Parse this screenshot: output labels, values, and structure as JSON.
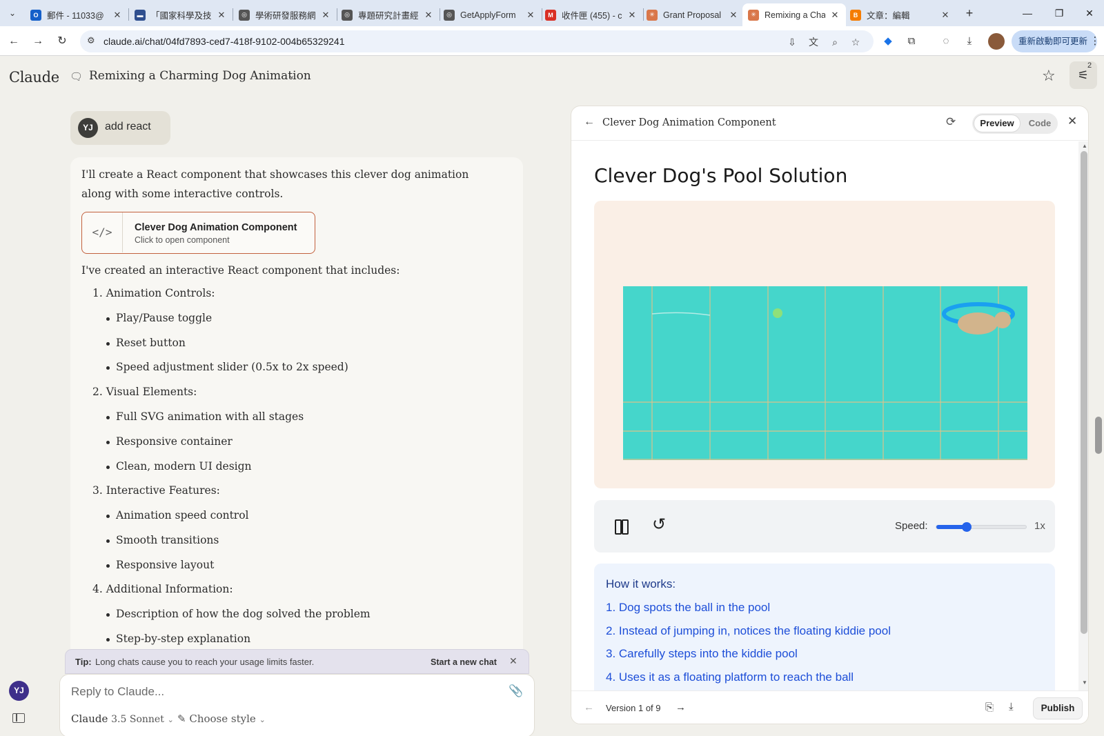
{
  "browser": {
    "tabs": [
      {
        "title": "郵件 - 11033@",
        "icon": "outlook-icon",
        "color": "#1560c9",
        "glyph": "O"
      },
      {
        "title": "「國家科學及技",
        "icon": "site-icon",
        "color": "#2f4f8f",
        "glyph": "▬"
      },
      {
        "title": "學術研發服務網",
        "icon": "globe-icon",
        "color": "#555555",
        "glyph": "◎"
      },
      {
        "title": "專題研究計畫經",
        "icon": "globe-icon",
        "color": "#555555",
        "glyph": "◎"
      },
      {
        "title": "GetApplyForm",
        "icon": "globe-icon",
        "color": "#555555",
        "glyph": "◎"
      },
      {
        "title": "收件匣 (455) - c",
        "icon": "gmail-icon",
        "color": "#d93025",
        "glyph": "M"
      },
      {
        "title": "Grant Proposal",
        "icon": "claude-icon",
        "color": "#d9774a",
        "glyph": "✳"
      },
      {
        "title": "Remixing a Cha",
        "icon": "claude-icon",
        "color": "#d9774a",
        "glyph": "✳"
      },
      {
        "title": "文章：編輯",
        "icon": "blogger-icon",
        "color": "#f57c00",
        "glyph": "B"
      }
    ],
    "url": "claude.ai/chat/04fd7893-ced7-418f-9102-004b65329241",
    "update_button": "重新啟動即可更新"
  },
  "app": {
    "logo": "Claude",
    "chat_title": "Remixing a Charming Dog Animation",
    "settings_badge": "2"
  },
  "chat": {
    "user_initials": "YJ",
    "user_message": "add react",
    "intro_line1": "I'll create a React component that showcases this clever dog animation",
    "intro_line2": "along with some interactive controls.",
    "artifact": {
      "title": "Clever Dog Animation Component",
      "subtitle": "Click to open component",
      "icon": "</>"
    },
    "includes_heading": "I've created an interactive React component that includes:",
    "sections": [
      {
        "label": "1. Animation Controls:",
        "bullets": [
          "Play/Pause toggle",
          "Reset button",
          "Speed adjustment slider (0.5x to 2x speed)"
        ]
      },
      {
        "label": "2. Visual Elements:",
        "bullets": [
          "Full SVG animation with all stages",
          "Responsive container",
          "Clean, modern UI design"
        ]
      },
      {
        "label": "3. Interactive Features:",
        "bullets": [
          "Animation speed control",
          "Smooth transitions",
          "Responsive layout"
        ]
      },
      {
        "label": "4. Additional Information:",
        "bullets": [
          "Description of how the dog solved the problem",
          "Step-by-step explanation"
        ]
      }
    ],
    "tip_label": "Tip:",
    "tip_text": "Long chats cause you to reach your usage limits faster.",
    "tip_link": "Start a new chat",
    "composer_placeholder": "Reply to Claude...",
    "model_name": "Claude",
    "model_version": "3.5 Sonnet",
    "style_label": "Choose style"
  },
  "panel": {
    "title": "Clever Dog Animation Component",
    "tab_preview": "Preview",
    "tab_code": "Code",
    "component_title": "Clever Dog's Pool Solution",
    "speed_label": "Speed:",
    "speed_value": "1x",
    "speed_fraction": 0.33,
    "howto_title": "How it works:",
    "steps": [
      "1. Dog spots the ball in the pool",
      "2. Instead of jumping in, notices the floating kiddie pool",
      "3. Carefully steps into the kiddie pool",
      "4. Uses it as a floating platform to reach the ball"
    ],
    "version_text": "Version 1 of 9",
    "publish_label": "Publish"
  },
  "colors": {
    "pool_water": "#45d6cb",
    "pool_grid": "#d9c38a",
    "stage_bg": "#faefe6",
    "ball": "#8ee07a",
    "kiddie_pool": "#1aa0f0",
    "dog": "#d2b48c",
    "accent_slider": "#2563eb",
    "artifact_border": "#c2603d"
  }
}
